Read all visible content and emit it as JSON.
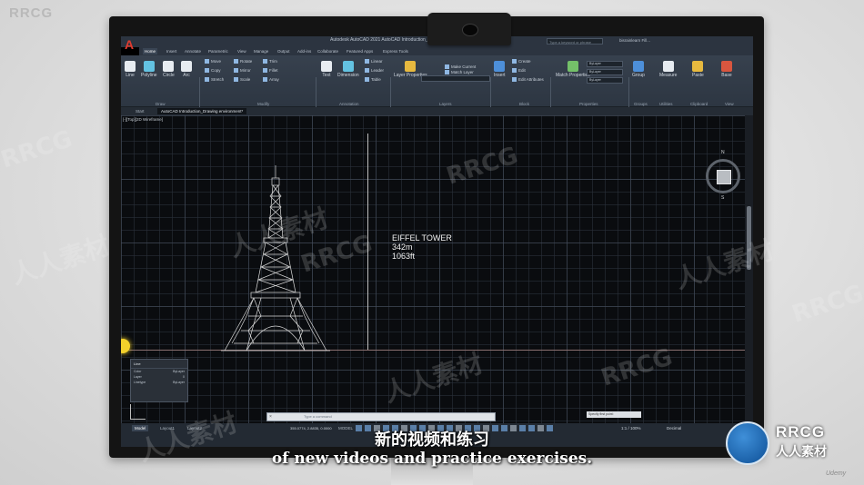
{
  "watermarks": {
    "corner": "RRCG",
    "rrcg": "RRCG",
    "cn": "人人素材"
  },
  "app": {
    "title": "Autodesk AutoCAD 2021   AutoCAD Introduction_Day 01 - Drawing environment.dwg",
    "search_placeholder": "Type a keyword or phrase",
    "user": "bisrainlearn Fill...",
    "ribbon_tabs": [
      "Home",
      "Insert",
      "Annotate",
      "Parametric",
      "View",
      "Manage",
      "Output",
      "Add-ins",
      "Collaborate",
      "Featured Apps",
      "Express Tools"
    ],
    "active_tab_index": 0
  },
  "ribbon": {
    "draw": {
      "line": "Line",
      "polyline": "Polyline",
      "circle": "Circle",
      "arc": "Arc",
      "label": "Draw"
    },
    "modify": {
      "move": "Move",
      "rotate": "Rotate",
      "trim": "Trim",
      "copy": "Copy",
      "mirror": "Mirror",
      "fillet": "Fillet",
      "stretch": "Stretch",
      "scale": "Scale",
      "array": "Array",
      "label": "Modify"
    },
    "annotation": {
      "text": "Text",
      "dimension": "Dimension",
      "linear": "Linear",
      "leader": "Leader",
      "table": "Table",
      "label": "Annotation"
    },
    "layers": {
      "layer_properties": "Layer Properties",
      "make_current": "Make Current",
      "match_layer": "Match Layer",
      "label": "Layers"
    },
    "block": {
      "insert": "Insert",
      "create": "Create",
      "edit": "Edit",
      "edit_attributes": "Edit Attributes",
      "label": "Block"
    },
    "properties": {
      "match_properties": "Match Properties",
      "bylayer": "ByLayer",
      "label": "Properties"
    },
    "groups": {
      "group": "Group",
      "label": "Groups"
    },
    "utilities": {
      "measure": "Measure",
      "label": "Utilities"
    },
    "clipboard": {
      "paste": "Paste",
      "label": "Clipboard"
    },
    "view": {
      "base": "Base",
      "label": "View"
    }
  },
  "file_tabs": [
    "Start",
    "AutoCAD Introduction_Drawing environment*"
  ],
  "viewport_label": "[-][Top][2D Wireframe]",
  "drawing": {
    "annotation": [
      "EIFFEL TOWER",
      "342m",
      "1063ft"
    ]
  },
  "viewcube": {
    "north": "N",
    "south": "S",
    "face": "TOP"
  },
  "properties_box": {
    "title": "Line",
    "rows": [
      {
        "label": "Color",
        "value": "ByLayer"
      },
      {
        "label": "Layer",
        "value": "0"
      },
      {
        "label": "Linetype",
        "value": "ByLayer"
      }
    ]
  },
  "tooltip": "Specify first point:",
  "command": {
    "placeholder": "Type a command",
    "close": "×"
  },
  "status": {
    "layout_tabs": [
      "Model",
      "Layout1",
      "Layout2"
    ],
    "active_layout": 0,
    "coords": "355.0774, 2.8835, 0.0000",
    "model": "MODEL",
    "scale": "1:1 / 100%",
    "units": "Decimal"
  },
  "subtitles": {
    "cn": "新的视频和练习",
    "en": "of new videos and practice exercises."
  },
  "brand": {
    "name": "RRCG",
    "cn": "人人素材"
  },
  "udemy": "Udemy"
}
